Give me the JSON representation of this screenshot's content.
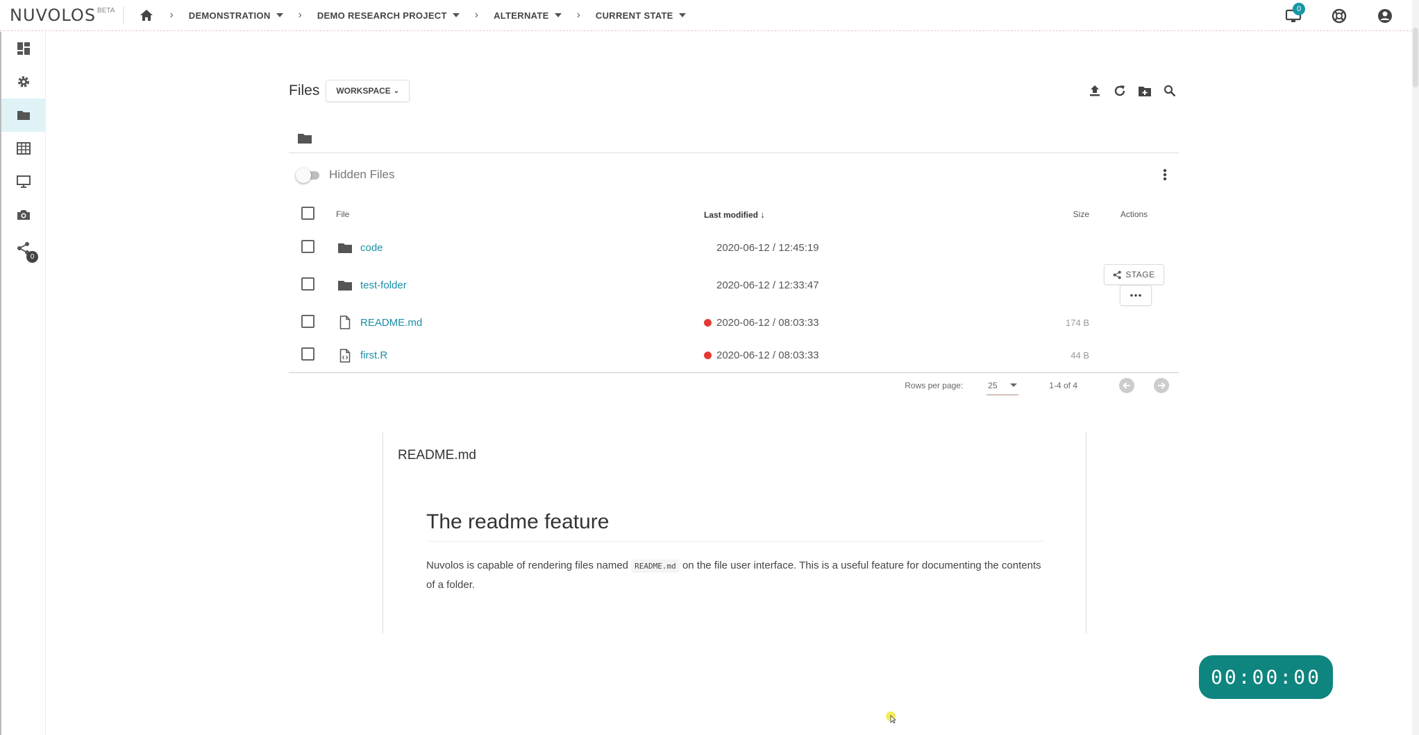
{
  "brand": {
    "name": "NUVOLOS",
    "beta": "BETA"
  },
  "breadcrumbs": [
    {
      "label": "DEMONSTRATION"
    },
    {
      "label": "DEMO RESEARCH PROJECT"
    },
    {
      "label": "ALTERNATE"
    },
    {
      "label": "CURRENT STATE"
    }
  ],
  "topbar": {
    "notifications_count": "0"
  },
  "sidebar": {
    "items": [
      {
        "icon": "dashboard-icon"
      },
      {
        "icon": "gear-icon"
      },
      {
        "icon": "folder-icon",
        "active": true
      },
      {
        "icon": "table-icon"
      },
      {
        "icon": "monitor-icon"
      },
      {
        "icon": "camera-icon"
      },
      {
        "icon": "share-icon",
        "badge": "0"
      }
    ]
  },
  "files": {
    "title": "Files",
    "workspace_label": "WORKSPACE",
    "hidden_files_label": "Hidden Files",
    "columns": {
      "file": "File",
      "modified": "Last modified",
      "size": "Size",
      "actions": "Actions"
    },
    "rows": [
      {
        "name": "code",
        "type": "folder",
        "modified": "2020-06-12 / 12:45:19",
        "size": "",
        "changed": false
      },
      {
        "name": "test-folder",
        "type": "folder",
        "modified": "2020-06-12 / 12:33:47",
        "size": "",
        "changed": false,
        "actions": [
          "STAGE",
          "..."
        ]
      },
      {
        "name": "README.md",
        "type": "file",
        "modified": "2020-06-12 / 08:03:33",
        "size": "174 B",
        "changed": true
      },
      {
        "name": "first.R",
        "type": "code-file",
        "modified": "2020-06-12 / 08:03:33",
        "size": "44 B",
        "changed": true
      }
    ],
    "pagination": {
      "rows_per_page_label": "Rows per page:",
      "rows_per_page": "25",
      "range": "1-4 of 4"
    }
  },
  "readme": {
    "filename": "README.md",
    "heading": "The readme feature",
    "para_before": "Nuvolos is capable of rendering files named ",
    "para_code": "README.md",
    "para_after": " on the file user interface. This is a useful feature for documenting the contents of a folder."
  },
  "timer": "00:00:00",
  "colors": {
    "accent": "#1a8fa6",
    "timer_bg": "#0e857f",
    "changed_dot": "#e53935",
    "active_side": "#dff3f6"
  }
}
